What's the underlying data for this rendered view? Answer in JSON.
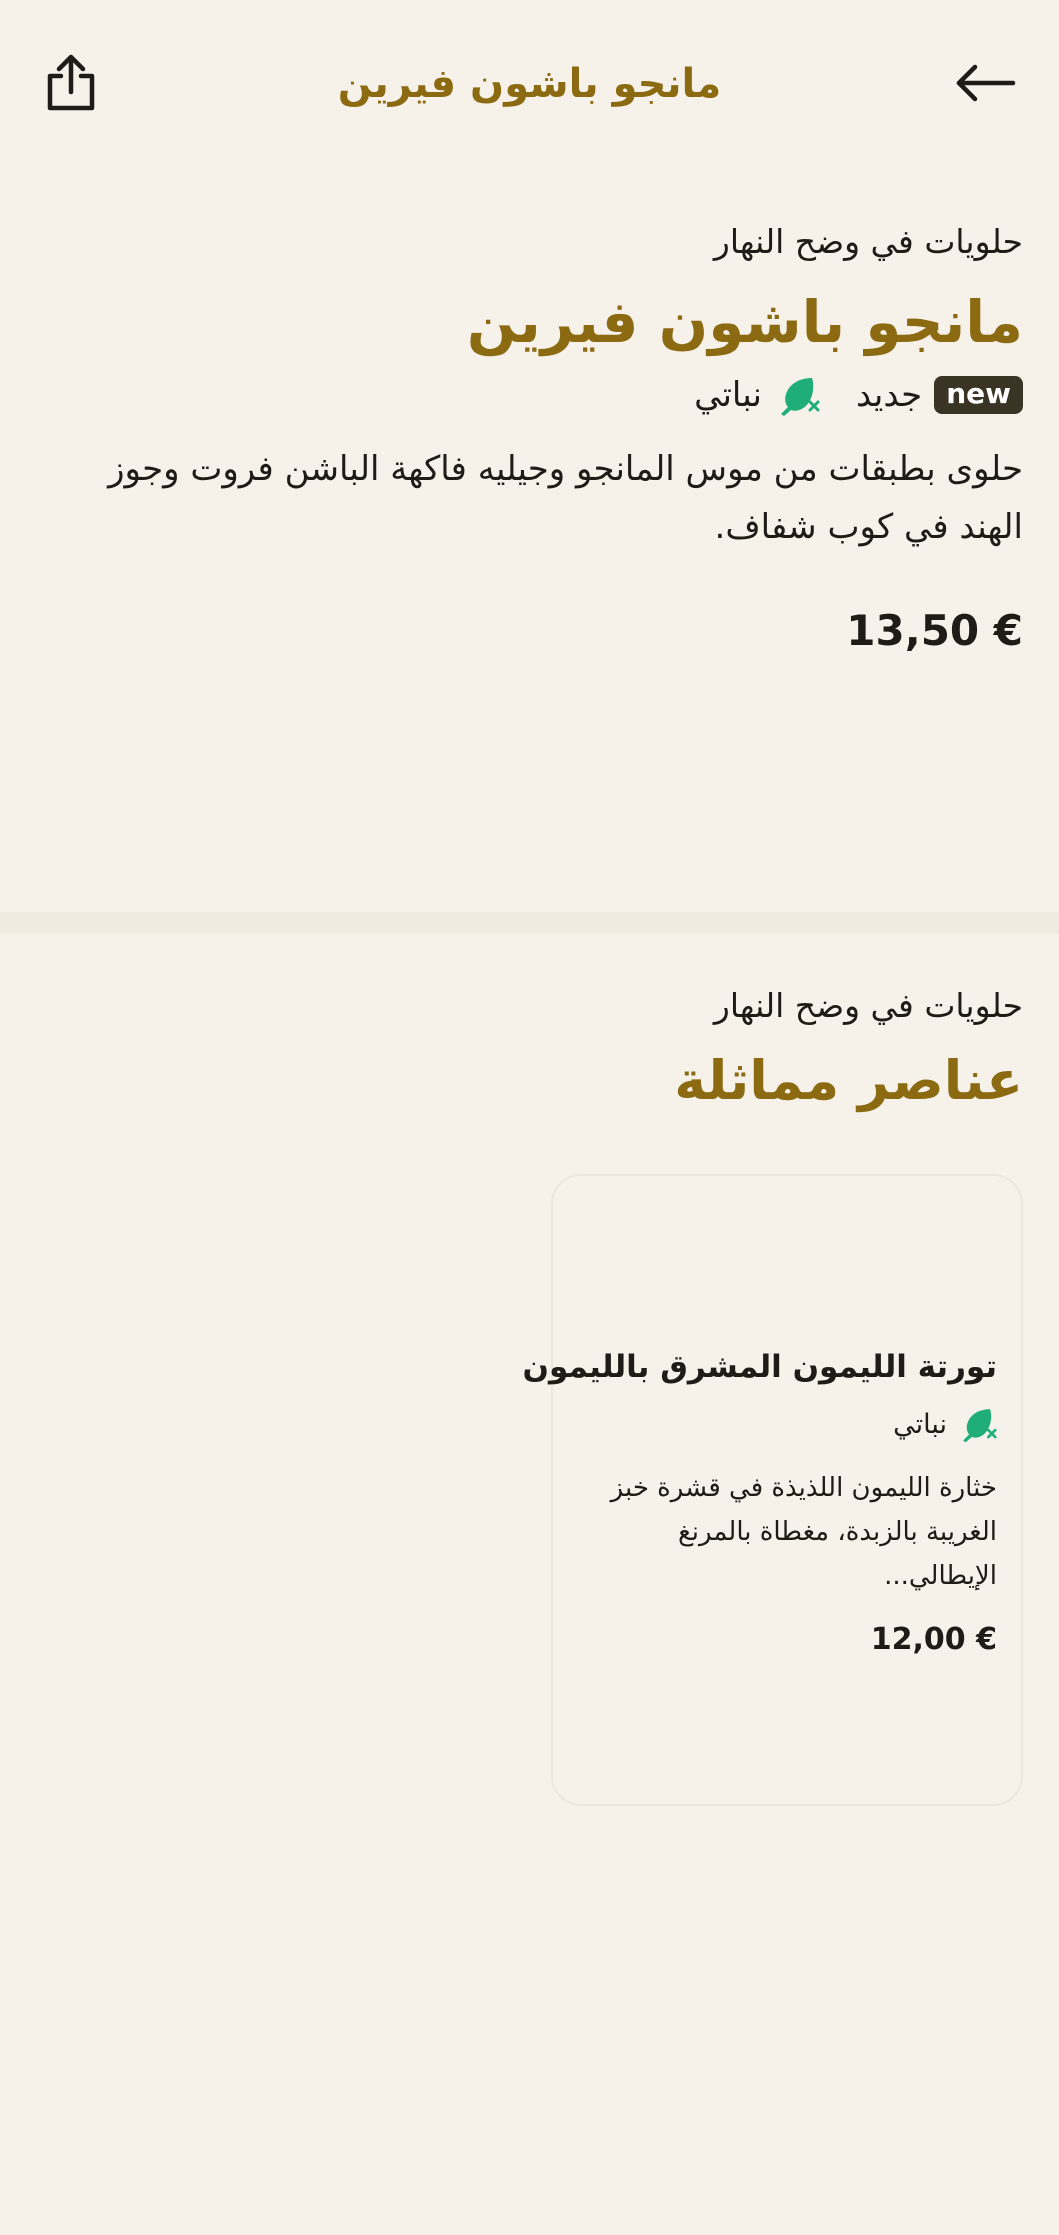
{
  "header": {
    "title": "مانجو باشون فيرين"
  },
  "item": {
    "category": "حلويات في وضح النهار",
    "title": "مانجو باشون فيرين",
    "badge_new": "new",
    "tag_new": "جديد",
    "tag_vegetarian": "نباتي",
    "description": "حلوى بطبقات من موس المانجو وجيليه فاكهة الباشن فروت وجوز الهند في كوب شفاف.",
    "price": "13,50 €"
  },
  "similar": {
    "category": "حلويات في وضح النهار",
    "title": "عناصر مماثلة",
    "items": [
      {
        "title": "تورتة الليمون المشرق بالليمون",
        "tag_vegetarian": "نباتي",
        "description": "خثارة الليمون اللذيذة في قشرة خبز الغريبة بالزبدة، مغطاة بالمرنغ الإيطالي...",
        "price": "12,00 €"
      }
    ]
  },
  "colors": {
    "background": "#f6f2ea",
    "accent": "#8b6a12",
    "vegetarian_icon": "#1fae7a",
    "new_badge_bg": "#3a3424"
  },
  "icons": {
    "share": "share-icon",
    "back": "arrow-left-icon",
    "vegetarian": "vegetarian-leaf-icon"
  }
}
